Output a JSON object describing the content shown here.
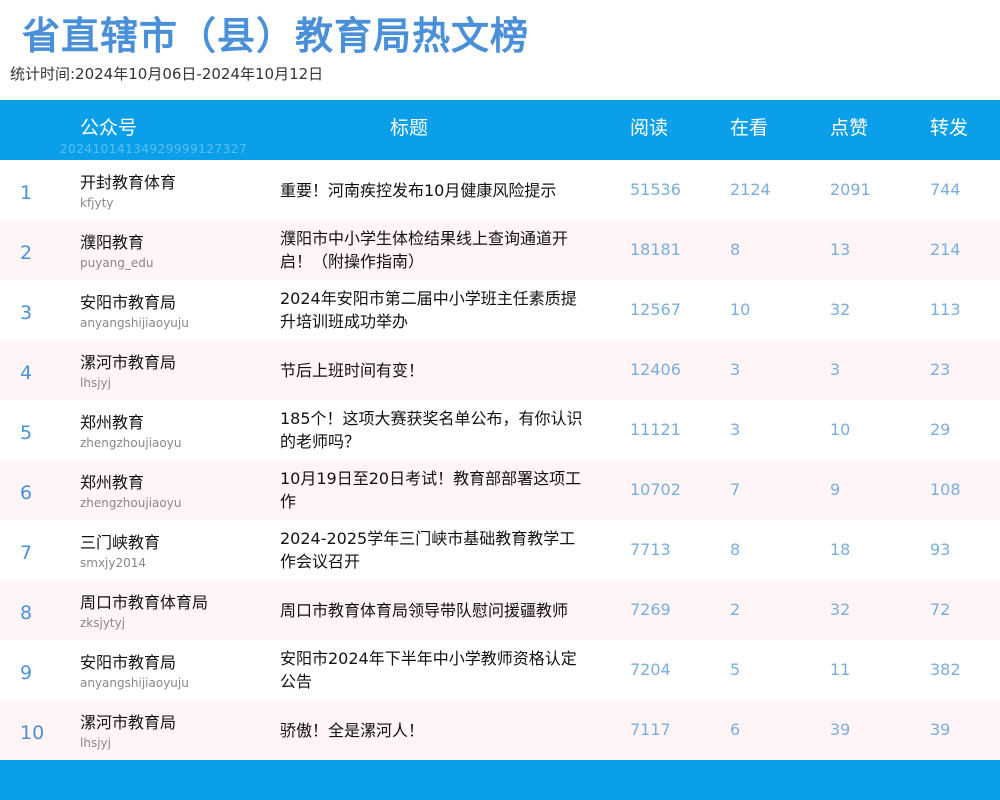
{
  "title": "省直辖市（县）教育局热文榜",
  "period": "统计时间:2024年10月06日-2024年10月12日",
  "header": {
    "account": "公众号",
    "title": "标题",
    "read": "阅读",
    "watch": "在看",
    "like": "点赞",
    "share": "转发",
    "watermark": "20241014134929999127327"
  },
  "rows": [
    {
      "rank": "1",
      "name": "开封教育体育",
      "id": "kfjyty",
      "title": "重要！河南疾控发布10月健康风险提示",
      "read": "51536",
      "watch": "2124",
      "like": "2091",
      "share": "744"
    },
    {
      "rank": "2",
      "name": "濮阳教育",
      "id": "puyang_edu",
      "title": "濮阳市中小学生体检结果线上查询通道开启！（附操作指南）",
      "read": "18181",
      "watch": "8",
      "like": "13",
      "share": "214"
    },
    {
      "rank": "3",
      "name": "安阳市教育局",
      "id": "anyangshijiaoyuju",
      "title": "2024年安阳市第二届中小学班主任素质提升培训班成功举办",
      "read": "12567",
      "watch": "10",
      "like": "32",
      "share": "113"
    },
    {
      "rank": "4",
      "name": "漯河市教育局",
      "id": "lhsjyj",
      "title": "节后上班时间有变！",
      "read": "12406",
      "watch": "3",
      "like": "3",
      "share": "23"
    },
    {
      "rank": "5",
      "name": "郑州教育",
      "id": "zhengzhoujiaoyu",
      "title": "185个！这项大赛获奖名单公布，有你认识的老师吗？",
      "read": "11121",
      "watch": "3",
      "like": "10",
      "share": "29"
    },
    {
      "rank": "6",
      "name": "郑州教育",
      "id": "zhengzhoujiaoyu",
      "title": "10月19日至20日考试！教育部部署这项工作",
      "read": "10702",
      "watch": "7",
      "like": "9",
      "share": "108"
    },
    {
      "rank": "7",
      "name": "三门峡教育",
      "id": "smxjy2014",
      "title": "2024-2025学年三门峡市基础教育教学工作会议召开",
      "read": "7713",
      "watch": "8",
      "like": "18",
      "share": "93"
    },
    {
      "rank": "8",
      "name": "周口市教育体育局",
      "id": "zksjytyj",
      "title": "周口市教育体育局领导带队慰问援疆教师",
      "read": "7269",
      "watch": "2",
      "like": "32",
      "share": "72"
    },
    {
      "rank": "9",
      "name": "安阳市教育局",
      "id": "anyangshijiaoyuju",
      "title": "安阳市2024年下半年中小学教师资格认定公告",
      "read": "7204",
      "watch": "5",
      "like": "11",
      "share": "382"
    },
    {
      "rank": "10",
      "name": "漯河市教育局",
      "id": "lhsjyj",
      "title": "骄傲！全是漯河人！",
      "read": "7117",
      "watch": "6",
      "like": "39",
      "share": "39"
    }
  ],
  "colors": {
    "header_bg": "#0a9fe8",
    "title_color": "#4a90d9",
    "row_alt_bg": "#fff4f6",
    "number_color": "#7aaede"
  }
}
